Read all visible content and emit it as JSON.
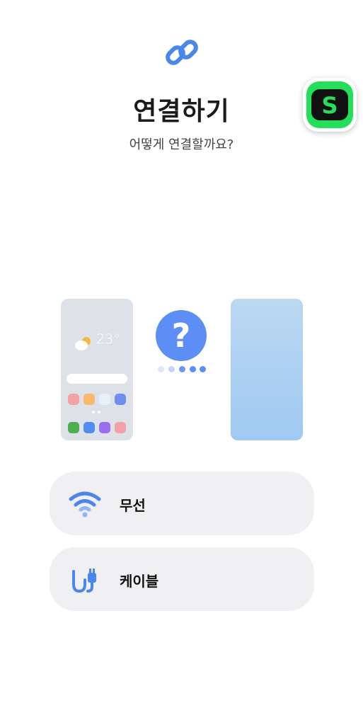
{
  "header": {
    "icon": "link-icon",
    "title": "연결하기",
    "subtitle": "어떻게 연결할까요?"
  },
  "floating_app": {
    "icon": "letter-s-app-icon",
    "letter": "S",
    "color": "#23e05a"
  },
  "illustration": {
    "old_phone": {
      "weather_icon": "partly-cloudy-icon",
      "temperature": "23°"
    },
    "status_icon": "question-mark-icon",
    "question_glyph": "?",
    "accent_color": "#5d8ef5"
  },
  "options": [
    {
      "label": "무선",
      "icon": "wifi-icon"
    },
    {
      "label": "케이블",
      "icon": "cable-icon"
    }
  ]
}
